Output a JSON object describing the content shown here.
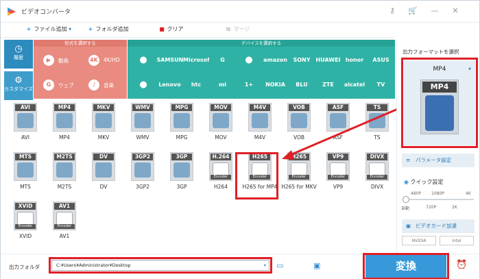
{
  "app": {
    "title": "ビデオコンバータ"
  },
  "toolbar": {
    "add_file": "ファイル追加",
    "add_folder": "フォルダ追加",
    "clear": "クリア",
    "merge": "マージ"
  },
  "categories": [
    {
      "label": "履歴"
    },
    {
      "label": "カスタマイズ"
    }
  ],
  "format_panel": {
    "title": "形式を選択する",
    "items": [
      {
        "label": "動画",
        "icon": "▶"
      },
      {
        "label": "4K/HD",
        "icon": "4K"
      },
      {
        "label": "ウェブ",
        "icon": "G"
      },
      {
        "label": "音楽",
        "icon": "♪"
      }
    ]
  },
  "device_panel": {
    "title": "デバイスを選択する",
    "row1": [
      "",
      "SAMSUNG",
      "Microsoft",
      "G",
      "",
      "amazon",
      "SONY",
      "HUAWEI",
      "honor",
      "ASUS"
    ],
    "row2": [
      "",
      "Lenovo",
      "htc",
      "mi",
      "1+",
      "NOKIA",
      "BLU",
      "ZTE",
      "alcatel",
      "TV"
    ]
  },
  "formats": [
    {
      "head": "AVI",
      "label": "AVI",
      "enc": ""
    },
    {
      "head": "MP4",
      "label": "MP4",
      "enc": ""
    },
    {
      "head": "MKV",
      "label": "MKV",
      "enc": ""
    },
    {
      "head": "WMV",
      "label": "WMV",
      "enc": ""
    },
    {
      "head": "MPG",
      "label": "MPG",
      "enc": ""
    },
    {
      "head": "MOV",
      "label": "MOV",
      "enc": ""
    },
    {
      "head": "M4V",
      "label": "M4V",
      "enc": ""
    },
    {
      "head": "VOB",
      "label": "VOB",
      "enc": ""
    },
    {
      "head": "ASF",
      "label": "ASF",
      "enc": ""
    },
    {
      "head": "TS",
      "label": "TS",
      "enc": ""
    },
    {
      "head": "MTS",
      "label": "MTS",
      "enc": ""
    },
    {
      "head": "M2TS",
      "label": "M2TS",
      "enc": ""
    },
    {
      "head": "DV",
      "label": "DV",
      "enc": ""
    },
    {
      "head": "3GP2",
      "label": "3GP2",
      "enc": ""
    },
    {
      "head": "3GP",
      "label": "3GP",
      "enc": ""
    },
    {
      "head": "H.264",
      "label": "H264",
      "enc": "Encoder"
    },
    {
      "head": "H265",
      "label": "H265 for MP4",
      "enc": "Encoder"
    },
    {
      "head": "H265",
      "label": "H265 for MKV",
      "enc": "Encoder"
    },
    {
      "head": "VP9",
      "label": "VP9",
      "enc": "Encoder"
    },
    {
      "head": "DIVX",
      "label": "DIVX",
      "enc": "Encoder"
    },
    {
      "head": "XVID",
      "label": "XVID",
      "enc": "Encoder"
    },
    {
      "head": "AV1",
      "label": "AV1",
      "enc": "Encoder"
    }
  ],
  "right": {
    "output_format_title": "出力フォーマットを選択",
    "selected_format": "MP4",
    "param_label": "パラメータ設定",
    "quick_label": "クイック設定",
    "quality_top": [
      "480P",
      "1080P",
      "4K"
    ],
    "quality_bottom": [
      "自動",
      "720P",
      "2K"
    ],
    "gpu_label": "ビデオカード加速",
    "nvidia": "NVIDIA",
    "intel": "Intel"
  },
  "bottom": {
    "output_folder_label": "出力フォルダ",
    "path": "C:¥Users¥Administrator¥Desktop",
    "convert": "変換"
  }
}
